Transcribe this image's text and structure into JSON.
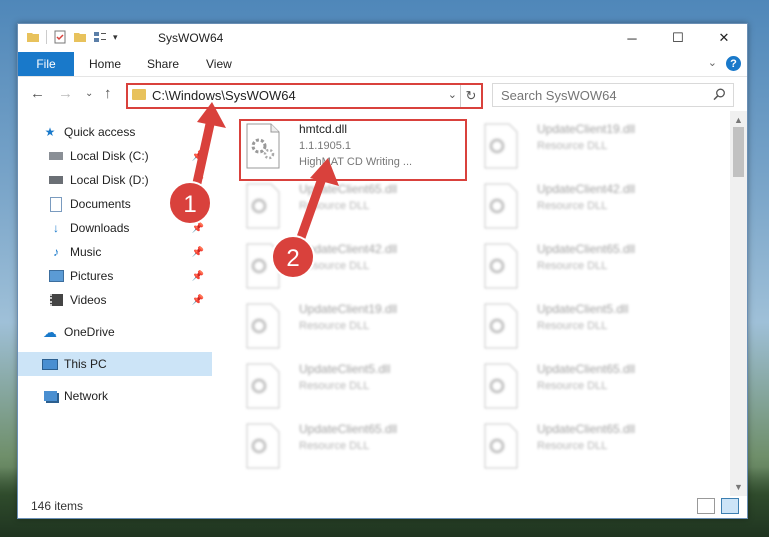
{
  "window": {
    "title": "SysWOW64"
  },
  "ribbon": {
    "file": "File",
    "home": "Home",
    "share": "Share",
    "view": "View",
    "help": "?"
  },
  "address": {
    "path": "C:\\Windows\\SysWOW64"
  },
  "search": {
    "placeholder": "Search SysWOW64"
  },
  "sidebar": {
    "items": [
      {
        "label": "Quick access",
        "icon": "star-icon"
      },
      {
        "label": "Local Disk (C:)",
        "icon": "drive-icon"
      },
      {
        "label": "Local Disk (D:)",
        "icon": "drive-icon"
      },
      {
        "label": "Documents",
        "icon": "documents-icon"
      },
      {
        "label": "Downloads",
        "icon": "download-icon"
      },
      {
        "label": "Music",
        "icon": "music-icon"
      },
      {
        "label": "Pictures",
        "icon": "pictures-icon"
      },
      {
        "label": "Videos",
        "icon": "videos-icon"
      },
      {
        "label": "OneDrive",
        "icon": "cloud-icon"
      },
      {
        "label": "This PC",
        "icon": "computer-icon"
      },
      {
        "label": "Network",
        "icon": "network-icon"
      }
    ]
  },
  "files": [
    {
      "name": "hmtcd.dll",
      "version": "1.1.1905.1",
      "desc": "HighMAT CD Writing ..."
    },
    {
      "name": "UpdateClient19.dll",
      "desc": "Resource DLL"
    },
    {
      "name": "UpdateClient65.dll",
      "desc": "Resource DLL"
    },
    {
      "name": "UpdateClient42.dll",
      "desc": "Resource DLL"
    },
    {
      "name": "UpdateClient42.dll",
      "desc": "Resource DLL"
    },
    {
      "name": "UpdateClient65.dll",
      "desc": "Resource DLL"
    },
    {
      "name": "UpdateClient19.dll",
      "desc": "Resource DLL"
    },
    {
      "name": "UpdateClient5.dll",
      "desc": "Resource DLL"
    },
    {
      "name": "UpdateClient5.dll",
      "desc": "Resource DLL"
    },
    {
      "name": "UpdateClient65.dll",
      "desc": "Resource DLL"
    },
    {
      "name": "UpdateClient65.dll",
      "desc": "Resource DLL"
    },
    {
      "name": "UpdateClient65.dll",
      "desc": "Resource DLL"
    }
  ],
  "status": {
    "count": "146 items"
  },
  "annotations": {
    "step1": "1",
    "step2": "2",
    "color": "#d9413c"
  }
}
